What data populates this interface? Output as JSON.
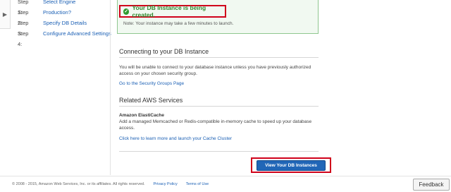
{
  "sidebar": {
    "toggle_icon": "chevron-right-icon",
    "toggle_glyph": "▶",
    "steps": [
      {
        "num": "Step 1:",
        "label": "Select Engine"
      },
      {
        "num": "Step 2:",
        "label": "Production?"
      },
      {
        "num": "Step 3:",
        "label": "Specify DB Details"
      },
      {
        "num": "Step 4:",
        "label": "Configure Advanced Settings"
      }
    ]
  },
  "status": {
    "title": "Your DB Instance is being created.",
    "icon": "check-circle-icon",
    "note": "Note: Your instance may take a few minutes to launch.",
    "color": "#2f8a2f"
  },
  "connect": {
    "heading": "Connecting to your DB Instance",
    "text": "You will be unable to connect to your database instance unless you have previously authorized access on your chosen security group.",
    "link": "Go to the Security Groups Page"
  },
  "related": {
    "heading": "Related AWS Services",
    "service_name": "Amazon ElastiCache",
    "service_text": "Add a managed Memcached or Redis-compatible in-memory cache to speed up your database access.",
    "link": "Click here to learn more and launch your Cache Cluster"
  },
  "actions": {
    "view_instances": "View Your DB Instances",
    "accent": "#2166b7"
  },
  "footer": {
    "copyright": "© 2008 - 2015, Amazon Web Services, Inc. or its affiliates. All rights reserved.",
    "privacy": "Privacy Policy",
    "terms": "Terms of Use",
    "feedback": "Feedback"
  }
}
